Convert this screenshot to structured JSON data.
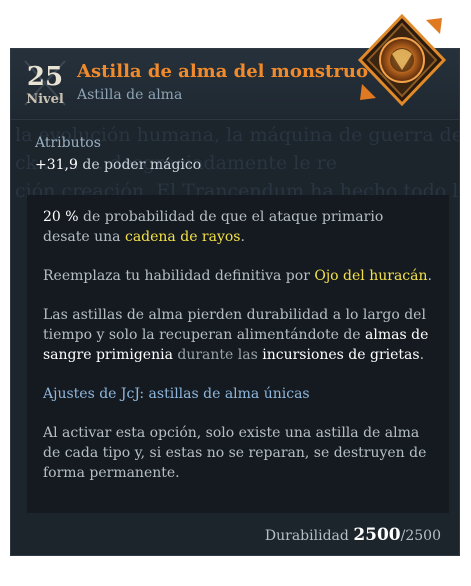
{
  "item": {
    "level": "25",
    "level_label": "Nivel",
    "title": "Astilla de alma del monstruo",
    "subtitle": "Astilla de alma"
  },
  "background_lore": [
    "la evolución humana, la máquina de guerra de",
    "ck... ... ... desgraciadamente le re",
    "ción creación. El Trancendum ha hecho todo lo p"
  ],
  "attributes": {
    "label": "Atributos",
    "value": "+31,9",
    "stat": "de poder mágico"
  },
  "effect1": {
    "percent": "20 %",
    "text_a": "de probabilidad de que el ataque primario desate una",
    "highlight": "cadena de rayos",
    "end": "."
  },
  "effect2": {
    "text_a": "Reemplaza tu habilidad definitiva por",
    "highlight": "Ojo del huracán",
    "end": "."
  },
  "effect3": {
    "text_a": "Las astillas de alma pierden durabilidad a lo largo del tiempo y solo la recuperan alimentándote de",
    "w1": "almas de sangre primigenia",
    "mid": "durante las",
    "w2": "incursiones de grietas",
    "end": "."
  },
  "pvp": {
    "title": "Ajustes de JcJ: astillas de alma únicas",
    "text": "Al activar esta opción, solo existe una astilla de alma de cada tipo y, si estas no se reparan, se destruyen de forma permanente."
  },
  "durability": {
    "label": "Durabilidad",
    "current": "2500",
    "max": "/2500"
  },
  "colors": {
    "title_orange": "#f08a2a",
    "highlight_yellow": "#f4e04b",
    "pvp_blue": "#8fb6dc",
    "panel_bg": "#1c242c"
  },
  "icons": {
    "emblem": "soul-shard-emblem-icon",
    "level_bg": "crossed-blades-icon"
  }
}
